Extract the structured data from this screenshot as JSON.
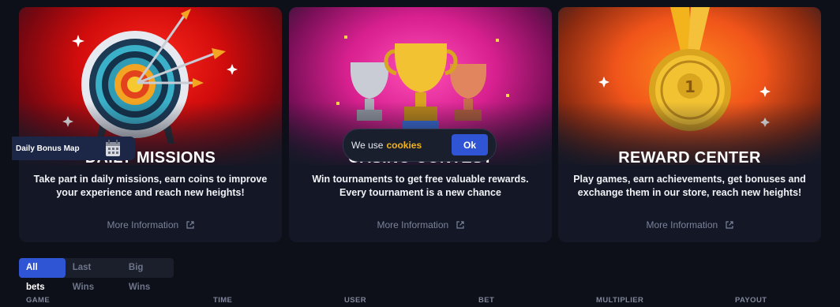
{
  "cards": [
    {
      "title": "DAILY MISSIONS",
      "description": "Take part in daily missions, earn coins to improve your experience and reach new heights!",
      "link": "More Information"
    },
    {
      "title": "CASINO CONTEST",
      "description": "Win tournaments to get free valuable rewards. Every tournament is a new chance",
      "link": "More Information"
    },
    {
      "title": "REWARD CENTER",
      "description": "Play games, earn achievements, get bonuses and exchange them in our store, reach new heights!",
      "link": "More Information"
    }
  ],
  "bonus_tab": {
    "label": "Daily Bonus Map",
    "icon": "calendar-icon"
  },
  "cookie_banner": {
    "text": "We use",
    "link": "cookies",
    "button": "Ok"
  },
  "bets_tabs": {
    "items": [
      "All bets",
      "Last Wins",
      "Big Wins"
    ],
    "active": "All bets"
  },
  "bets_table": {
    "columns": [
      "GAME",
      "TIME",
      "USER",
      "BET",
      "MULTIPLIER",
      "PAYOUT"
    ]
  },
  "colors": {
    "accent": "#2f55d4",
    "cookie_link": "#f2b31c",
    "background": "#0d1019",
    "card": "#141826"
  }
}
